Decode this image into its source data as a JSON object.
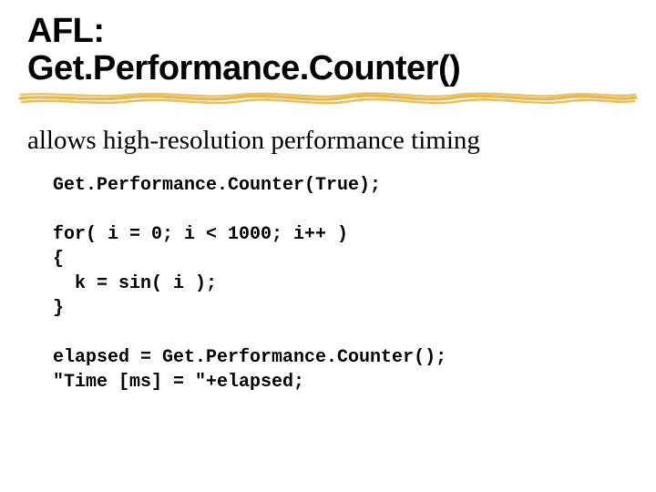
{
  "title": {
    "line1": "AFL:",
    "line2": "Get.Performance.Counter()"
  },
  "lead": "allows high-resolution performance timing",
  "code": {
    "l1": "Get.Performance.Counter(True);",
    "l2": "",
    "l3": "for( i = 0; i < 1000; i++ )",
    "l4": "{",
    "l5": "  k = sin( i );",
    "l6": "}",
    "l7": "",
    "l8": "elapsed = Get.Performance.Counter();",
    "l9": "\"Time [ms] = \"+elapsed;"
  }
}
